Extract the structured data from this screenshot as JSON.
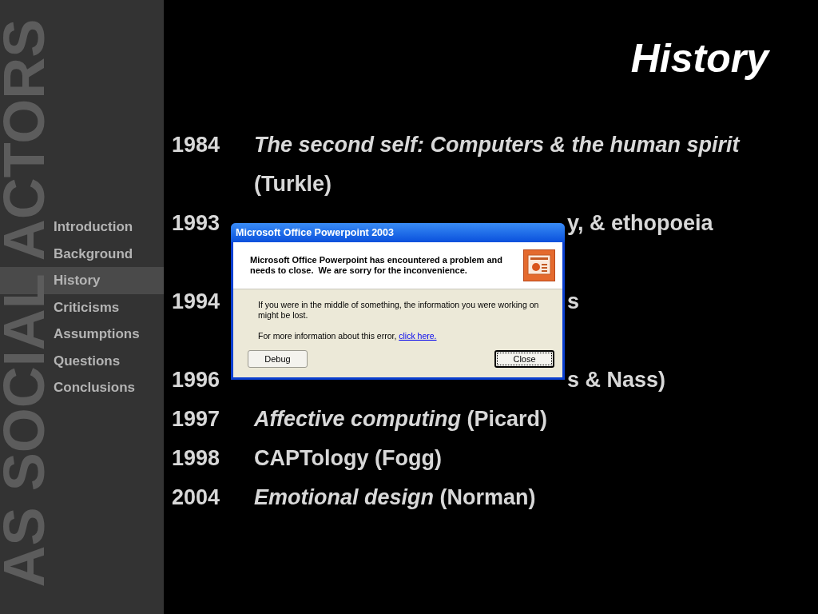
{
  "sidebar": {
    "watermark": "AS SOCIAL ACTORS",
    "items": [
      {
        "label": "Introduction",
        "selected": false
      },
      {
        "label": "Background",
        "selected": false
      },
      {
        "label": "History",
        "selected": true
      },
      {
        "label": "Criticisms",
        "selected": false
      },
      {
        "label": "Assumptions",
        "selected": false
      },
      {
        "label": "Questions",
        "selected": false
      },
      {
        "label": "Conclusions",
        "selected": false
      }
    ]
  },
  "title": "History",
  "timeline": [
    {
      "kind": "entry",
      "year": "1984",
      "lines": [
        "*The second self: Computers & the human spirit*",
        "(Turkle)"
      ]
    },
    {
      "kind": "fragment",
      "year": "1993",
      "lines": [
        "y, & ethopoeia"
      ]
    },
    {
      "kind": "fragment",
      "year": "1994",
      "lines": [
        "s"
      ]
    },
    {
      "kind": "clipped",
      "year": "1996",
      "lines": [
        "s & Nass)"
      ]
    },
    {
      "kind": "entry",
      "year": "1997",
      "lines": [
        "*Affective computing* (Picard)"
      ]
    },
    {
      "kind": "entry",
      "year": "1998",
      "lines": [
        "CAPTology (Fogg)"
      ]
    },
    {
      "kind": "entry",
      "year": "2004",
      "lines": [
        "*Emotional design* (Norman)"
      ]
    }
  ],
  "dialog": {
    "title": "Microsoft Office Powerpoint 2003",
    "headline": "Microsoft Office Powerpoint has encountered a problem and needs to close.  We are sorry for the inconvenience.",
    "message": "If you were in the middle of something, the information you were working on might be lost.",
    "info": "For more information about this error,",
    "link": "click here.",
    "buttons": [
      {
        "label": "Debug",
        "selected": false
      },
      {
        "label": "Close",
        "selected": true
      }
    ]
  }
}
